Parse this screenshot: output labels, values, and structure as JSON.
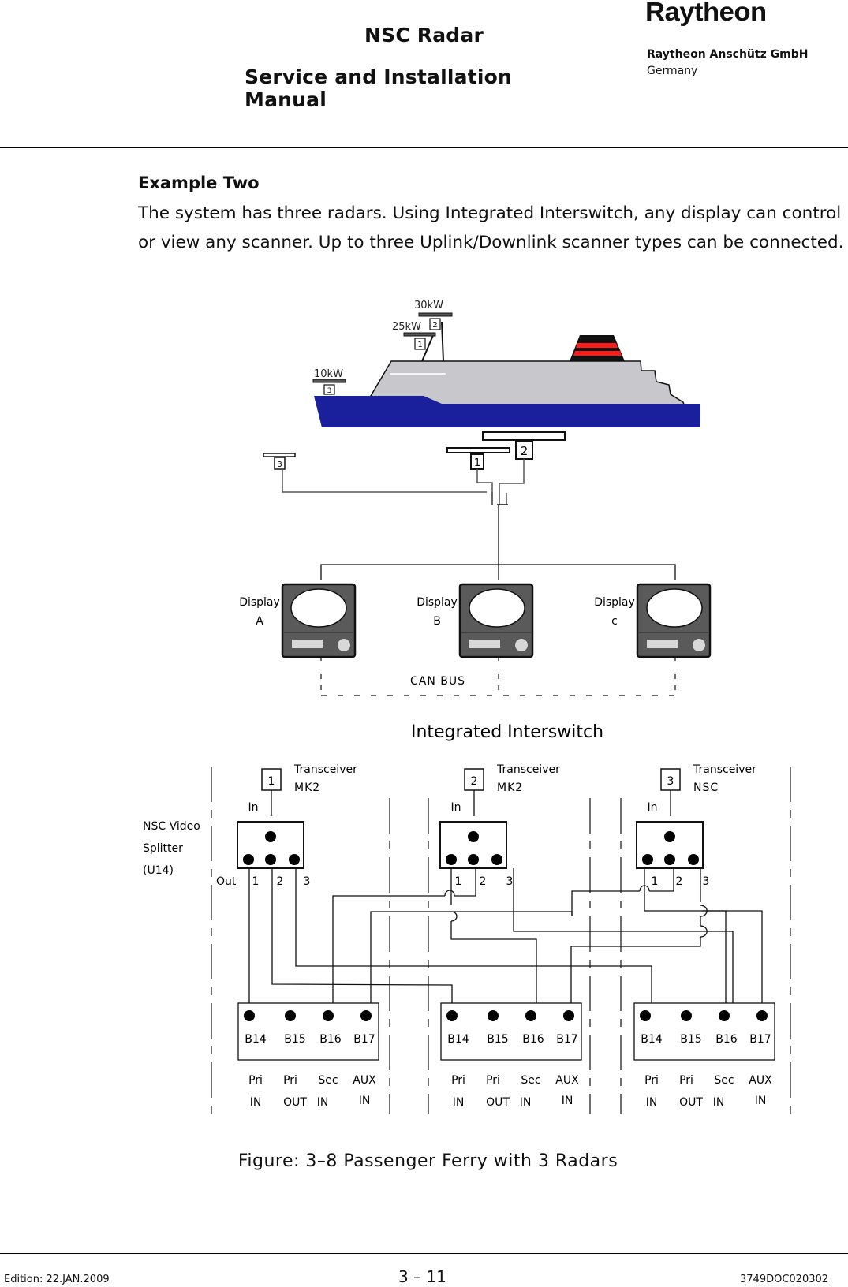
{
  "header": {
    "doc_title": "NSC Radar",
    "doc_subtitle": "Service and Installation Manual",
    "brand": "Raytheon",
    "company": "Raytheon Anschütz GmbH",
    "country": "Germany"
  },
  "content": {
    "heading": "Example Two",
    "paragraph": "The system has three radars. Using Integrated Interswitch, any display can control or view any scanner. Up to three Uplink/Downlink scanner types can be connected."
  },
  "ship_diagram": {
    "scanners_on_ship": [
      {
        "id": "1",
        "power": "25kW"
      },
      {
        "id": "2",
        "power": "30kW"
      },
      {
        "id": "3",
        "power": "10kW"
      }
    ],
    "schematic_scanners": [
      "1",
      "2",
      "3"
    ],
    "displays": [
      {
        "line1": "Display",
        "line2": "A"
      },
      {
        "line1": "Display",
        "line2": "B"
      },
      {
        "line1": "Display",
        "line2": "c"
      }
    ],
    "bus_label": "CAN BUS",
    "colors": {
      "hull": "#1a1f9c",
      "superstructure": "#c8c8cc",
      "funnel_stripe": "#ff1a1a",
      "display_body": "#5a5a5a"
    }
  },
  "interswitch": {
    "title": "Integrated Interswitch",
    "splitter_label": [
      "NSC Video",
      "Splitter",
      "(U14)"
    ],
    "in_label": "In",
    "out_label": "Out",
    "output_numbers": [
      "1",
      "2",
      "3"
    ],
    "transceivers": [
      {
        "id": "1",
        "line1": "Transceiver",
        "line2": "MK2"
      },
      {
        "id": "2",
        "line1": "Transceiver",
        "line2": "MK2"
      },
      {
        "id": "3",
        "line1": "Transceiver",
        "line2": "NSC"
      }
    ],
    "connector_pins": [
      "B14",
      "B15",
      "B16",
      "B17"
    ],
    "pin_functions": [
      {
        "line1": "Pri",
        "line2": "IN"
      },
      {
        "line1": "Pri",
        "line2": "OUT"
      },
      {
        "line1": "Sec",
        "line2": "IN"
      },
      {
        "line1": "AUX",
        "line2": "IN"
      }
    ]
  },
  "caption": "Figure: 3–8   Passenger Ferry with 3 Radars",
  "footer": {
    "edition": "Edition: 22.JAN.2009",
    "page": "3 – 11",
    "doc_number": "3749DOC020302"
  }
}
